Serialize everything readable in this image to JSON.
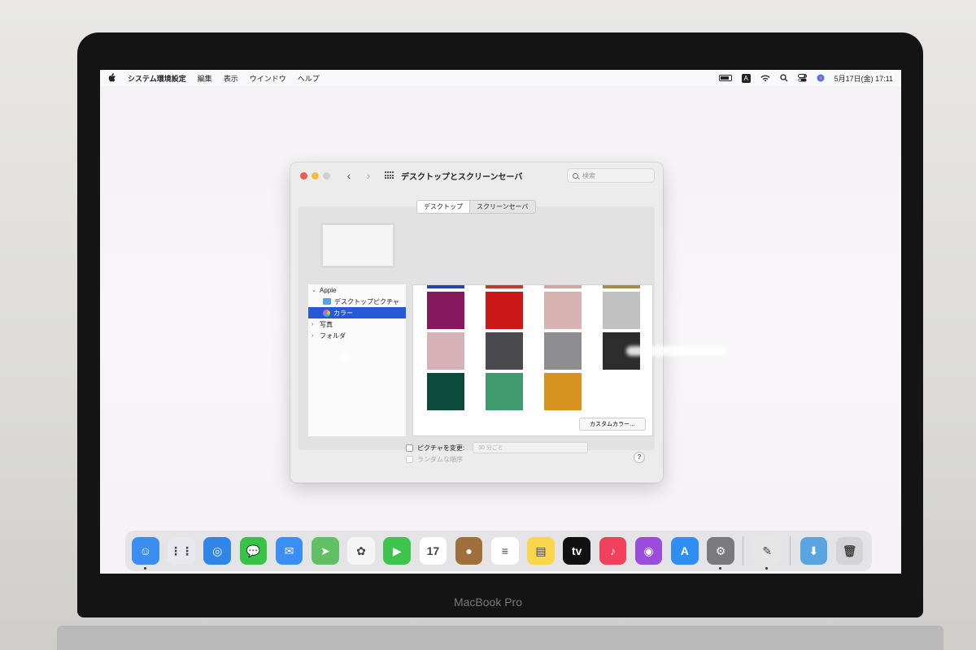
{
  "menubar": {
    "app_name": "システム環境設定",
    "items": [
      "編集",
      "表示",
      "ウインドウ",
      "ヘルプ"
    ],
    "input_mode": "A",
    "datetime": "5月17日(金) 17:11"
  },
  "window": {
    "title": "デスクトップとスクリーンセーバ",
    "search_placeholder": "検索",
    "tabs": [
      "デスクトップ",
      "スクリーンセーバ"
    ],
    "sidebar": {
      "group": "Apple",
      "children": [
        "デスクトップピクチャ",
        "カラー"
      ],
      "selected": "カラー",
      "others": [
        "写真",
        "フォルダ"
      ]
    },
    "swatch_colors": [
      "#86195e",
      "#cc1818",
      "#d9b3b1",
      "#c1c1c1",
      "#d7b1b8",
      "#4a4a4e",
      "#8e8e90",
      "#2d2d2d",
      "#0c4b3c",
      "#3f9a6e",
      "#d7921f"
    ],
    "top_strip_colors": [
      "#2a43b0",
      "#c23a2c",
      "#cfa7a4",
      "#a58a4e"
    ],
    "custom_color_button": "カスタムカラー…",
    "plus": "+",
    "minus": "−",
    "change_picture_label": "ピクチャを変更:",
    "interval_value": "30 分ごと",
    "random_order_label": "ランダムな順序",
    "help": "?"
  },
  "dock": {
    "apps": [
      {
        "name": "finder-icon",
        "color": "#3b8ef0",
        "glyph": "☺"
      },
      {
        "name": "launchpad-icon",
        "color": "#e8e8ee",
        "glyph": "⋮⋮"
      },
      {
        "name": "safari-icon",
        "color": "#2f86e8",
        "glyph": "◎"
      },
      {
        "name": "messages-icon",
        "color": "#37c346",
        "glyph": "💬"
      },
      {
        "name": "mail-icon",
        "color": "#3a8ff5",
        "glyph": "✉"
      },
      {
        "name": "maps-icon",
        "color": "#62c064",
        "glyph": "➤"
      },
      {
        "name": "photos-icon",
        "color": "#f5f5f5",
        "glyph": "✿"
      },
      {
        "name": "facetime-icon",
        "color": "#3dc44f",
        "glyph": "▶"
      },
      {
        "name": "calendar-icon",
        "color": "#ffffff",
        "glyph": "17"
      },
      {
        "name": "contacts-icon",
        "color": "#a0703c",
        "glyph": "●"
      },
      {
        "name": "reminders-icon",
        "color": "#ffffff",
        "glyph": "≡"
      },
      {
        "name": "notes-icon",
        "color": "#f9d64c",
        "glyph": "▤"
      },
      {
        "name": "tv-icon",
        "color": "#111111",
        "glyph": "tv"
      },
      {
        "name": "music-icon",
        "color": "#f2415c",
        "glyph": "♪"
      },
      {
        "name": "podcasts-icon",
        "color": "#9a4cdc",
        "glyph": "◉"
      },
      {
        "name": "app-store-icon",
        "color": "#2f8ef2",
        "glyph": "A"
      },
      {
        "name": "system-preferences-icon",
        "color": "#7a7a7e",
        "glyph": "⚙"
      }
    ],
    "utilities": [
      {
        "name": "migration-assistant-icon",
        "color": "#e6e6e6",
        "glyph": "✎"
      }
    ],
    "trash_group": [
      {
        "name": "downloads-folder-icon",
        "color": "#5aa4e2",
        "glyph": "⬇"
      },
      {
        "name": "trash-icon",
        "color": "#d4d4d6",
        "glyph": "🗑"
      }
    ]
  },
  "hardware": {
    "model_label": "MacBook Pro"
  }
}
